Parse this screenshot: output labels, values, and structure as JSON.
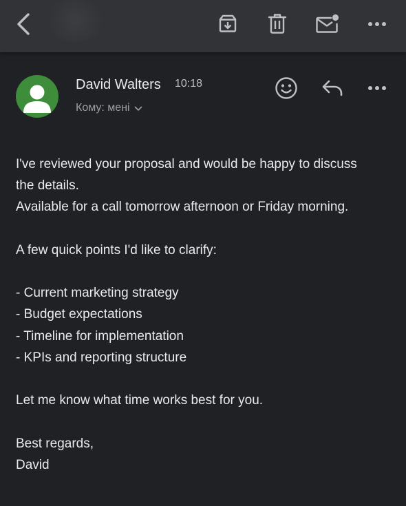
{
  "toolbar": {
    "back_icon": "chevron-left-icon",
    "archive_icon": "archive-icon",
    "delete_icon": "trash-icon",
    "mark_unread_icon": "mail-unread-icon",
    "more_icon": "more-horizontal-icon"
  },
  "email": {
    "sender_name": "David Walters",
    "time": "10:18",
    "recipient": "Кому: мені",
    "avatar_color": "#3e8d3a",
    "body_lines": [
      "I've reviewed your proposal and would be happy to discuss",
      "the details.",
      "Available for a call tomorrow afternoon or Friday morning.",
      "",
      "A few quick points I'd like to clarify:",
      "",
      "- Current marketing strategy",
      "- Budget expectations",
      "- Timeline for implementation",
      "- KPIs and reporting structure",
      "",
      "Let me know what time works best for you.",
      "",
      "Best regards,",
      "David"
    ]
  },
  "colors": {
    "background": "#202124",
    "appbar": "#323336",
    "text_primary": "#e8eaed",
    "text_secondary": "#9aa0a6",
    "icon": "#bdc1c6"
  }
}
